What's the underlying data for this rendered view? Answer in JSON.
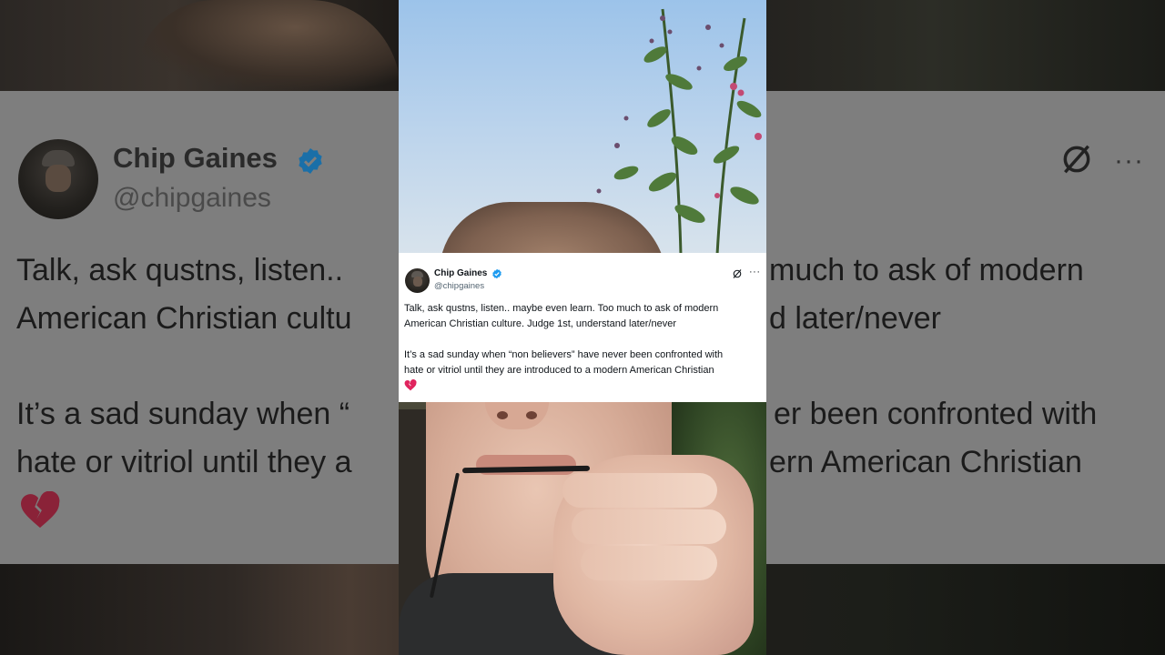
{
  "tweet": {
    "display_name": "Chip Gaines",
    "handle": "@chipgaines",
    "verified_badge_icon": "verified-check-icon",
    "paragraph_1": "Talk, ask qustns, listen.. maybe even learn. Too much to ask of modern\nAmerican Christian culture. Judge 1st, understand later/never",
    "paragraph_2": "It’s a sad sunday when “non believers” have never been confronted with\nhate or vitriol until they are introduced to a modern American Christian",
    "emoji_icon": "broken-heart-icon",
    "actions": {
      "grok_icon": "grok-icon",
      "more_label": "···"
    },
    "colors": {
      "badge": "#1d9bf0",
      "heart": "#e0245e"
    }
  },
  "background_zoom": {
    "display_name": "Chip Gaines",
    "handle": "@chipgaines",
    "line_1_left": "Talk, ask qustns, listen.. ",
    "line_1_right": "much to ask of modern",
    "line_2_left": "American Christian cultu",
    "line_2_right": "d later/never",
    "line_3_left": "It’s a sad sunday when “",
    "line_3_right": "er been confronted with",
    "line_4_left": "hate or vitriol until they a",
    "line_4_right": "ern American Christian",
    "more_label": "···"
  }
}
